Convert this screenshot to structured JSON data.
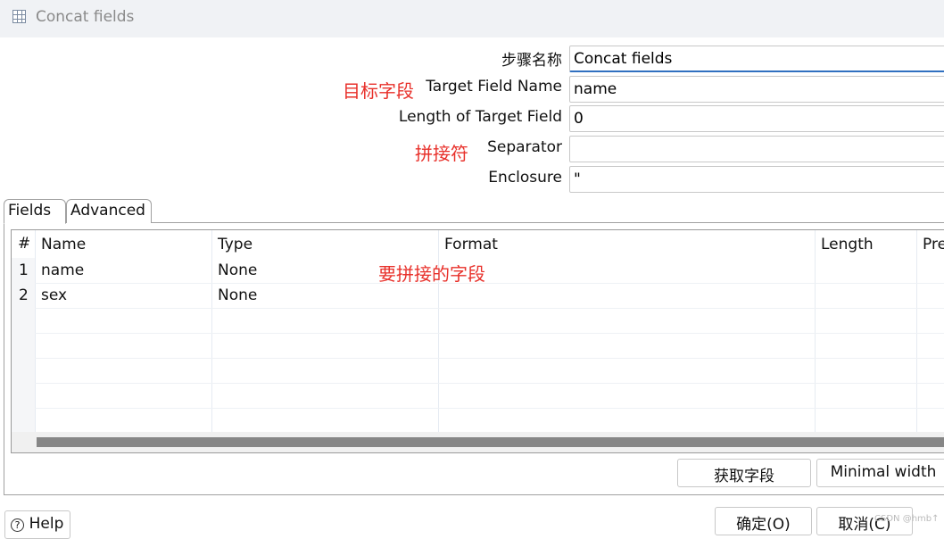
{
  "window": {
    "title": "Concat fields",
    "icon": "table-icon"
  },
  "form": {
    "step_name_label": "步骤名称",
    "step_name_value": "Concat fields",
    "target_field_label": "Target Field Name",
    "target_field_value": "name",
    "length_label": "Length of Target Field",
    "length_value": "0",
    "separator_label": "Separator",
    "separator_value": "",
    "enclosure_label": "Enclosure",
    "enclosure_value": "\""
  },
  "annotations": {
    "target": "目标字段",
    "separator": "拼接符",
    "fields": "要拼接的字段",
    "color": "#e8302a"
  },
  "tabs": [
    {
      "label": "Fields",
      "active": true
    },
    {
      "label": "Advanced",
      "active": false
    }
  ],
  "table": {
    "columns": [
      "#",
      "Name",
      "Type",
      "Format",
      "Length",
      "Pre"
    ],
    "rows": [
      [
        "1",
        "name",
        "None",
        "",
        ""
      ],
      [
        "2",
        "sex",
        "None",
        "",
        ""
      ]
    ]
  },
  "buttons": {
    "get_fields": "获取字段",
    "minimal_width": "Minimal width",
    "help": "Help",
    "ok": "确定(O)",
    "cancel": "取消(C)"
  },
  "watermark": "CSDN @hmb↑"
}
